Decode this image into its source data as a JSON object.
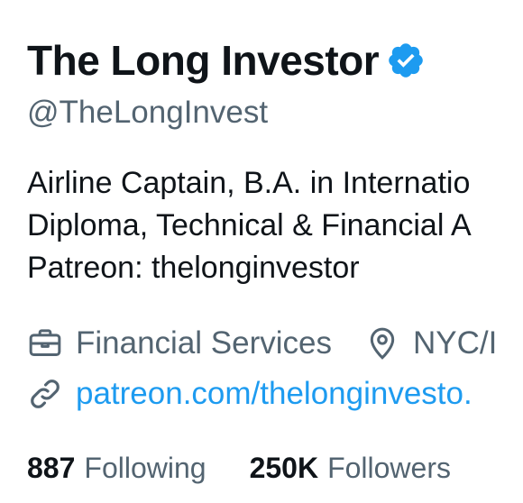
{
  "profile": {
    "display_name": "The Long Investor",
    "verified_icon": "verified-badge-icon",
    "handle": "@TheLongInvest",
    "bio_lines": [
      "Airline Captain, B.A. in Internatio",
      "Diploma, Technical & Financial A",
      "Patreon: thelonginvestor"
    ],
    "meta": {
      "category": "Financial Services",
      "category_icon": "briefcase-icon",
      "location": "NYC/I",
      "location_icon": "location-pin-icon",
      "website": "patreon.com/thelonginvesto.",
      "website_icon": "link-icon"
    },
    "stats": {
      "following_count": "887",
      "following_label": "Following",
      "followers_count": "250K",
      "followers_label": "Followers"
    }
  },
  "colors": {
    "text_primary": "#0f1419",
    "text_secondary": "#536471",
    "accent": "#1d9bf0"
  }
}
